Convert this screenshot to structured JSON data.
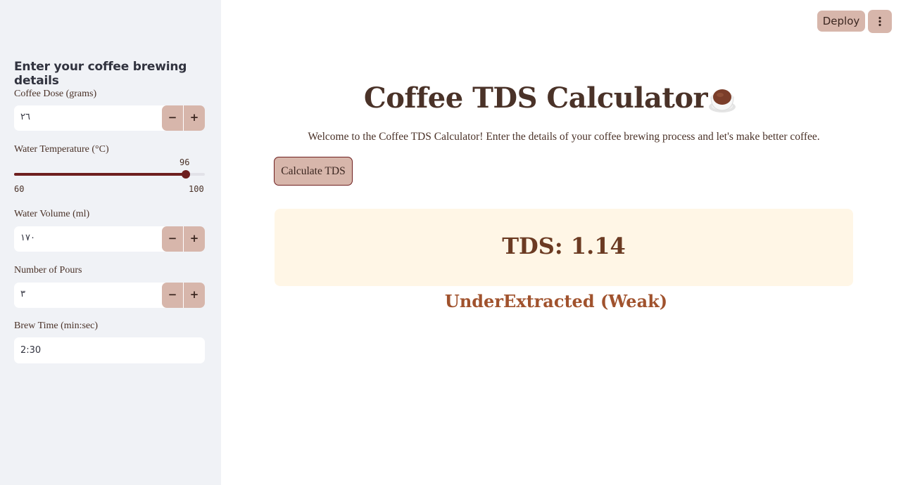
{
  "header": {
    "deploy_label": "Deploy",
    "menu_icon": "vertical-ellipsis-icon"
  },
  "sidebar": {
    "heading": "Enter your coffee brewing details",
    "coffee_dose": {
      "label": "Coffee Dose (grams)",
      "value": "٢٦",
      "minus": "−",
      "plus": "+"
    },
    "water_temp": {
      "label": "Water Temperature (°C)",
      "value": "96",
      "min": "60",
      "max": "100",
      "fraction": 0.9
    },
    "water_volume": {
      "label": "Water Volume (ml)",
      "value": "١٧٠",
      "minus": "−",
      "plus": "+"
    },
    "pours": {
      "label": "Number of Pours",
      "value": "٣",
      "minus": "−",
      "plus": "+"
    },
    "brew_time": {
      "label": "Brew Time (min:sec)",
      "value": "2:30"
    }
  },
  "main": {
    "title": "Coffee TDS Calculator",
    "title_icon": "coffee-cup-icon",
    "welcome": "Welcome to the Coffee TDS Calculator! Enter the details of your coffee brewing process and let's make better coffee.",
    "calculate_label": "Calculate TDS",
    "tds_result": "TDS: 1.14",
    "status": "UnderExtracted (Weak)"
  },
  "colors": {
    "accent": "#d7b6ab",
    "primary_dark": "#6e1f1f",
    "text_brown": "#4a3228",
    "result_bg": "#fff6e6",
    "status_color": "#a0522d",
    "sidebar_bg": "#f0f2f6"
  }
}
